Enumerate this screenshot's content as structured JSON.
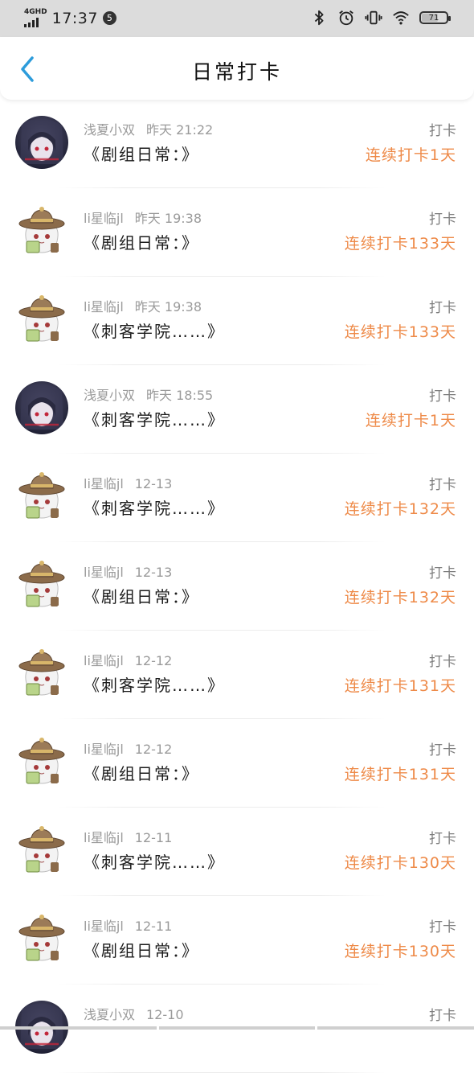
{
  "status_bar": {
    "network": "4GHD",
    "time": "17:37",
    "notification_count": "5",
    "battery": "71",
    "battery_level": 0.71,
    "icons": [
      "bluetooth-icon",
      "alarm-icon",
      "vibrate-icon",
      "wifi-icon",
      "battery-icon"
    ]
  },
  "header": {
    "title": "日常打卡",
    "back_icon": "chevron-left-icon"
  },
  "colors": {
    "accent": "#2d9cdb",
    "streak": "#ee8a48",
    "status_bar_bg": "#dcdcdc"
  },
  "entries": [
    {
      "user": "浅夏小双",
      "time": "昨天 21:22",
      "title": "《剧组日常：》",
      "action": "打卡",
      "streak": "连续打卡1天",
      "avatar": "dark-hair-girl"
    },
    {
      "user": "li星临jl",
      "time": "昨天 19:38",
      "title": "《剧组日常：》",
      "action": "打卡",
      "streak": "连续打卡133天",
      "avatar": "hat-chibi"
    },
    {
      "user": "li星临jl",
      "time": "昨天 19:38",
      "title": "《刺客学院……》",
      "action": "打卡",
      "streak": "连续打卡133天",
      "avatar": "hat-chibi"
    },
    {
      "user": "浅夏小双",
      "time": "昨天 18:55",
      "title": "《刺客学院……》",
      "action": "打卡",
      "streak": "连续打卡1天",
      "avatar": "dark-hair-girl"
    },
    {
      "user": "li星临jl",
      "time": "12-13",
      "title": "《刺客学院……》",
      "action": "打卡",
      "streak": "连续打卡132天",
      "avatar": "hat-chibi"
    },
    {
      "user": "li星临jl",
      "time": "12-13",
      "title": "《剧组日常：》",
      "action": "打卡",
      "streak": "连续打卡132天",
      "avatar": "hat-chibi"
    },
    {
      "user": "li星临jl",
      "time": "12-12",
      "title": "《刺客学院……》",
      "action": "打卡",
      "streak": "连续打卡131天",
      "avatar": "hat-chibi"
    },
    {
      "user": "li星临jl",
      "time": "12-12",
      "title": "《剧组日常：》",
      "action": "打卡",
      "streak": "连续打卡131天",
      "avatar": "hat-chibi"
    },
    {
      "user": "li星临jl",
      "time": "12-11",
      "title": "《刺客学院……》",
      "action": "打卡",
      "streak": "连续打卡130天",
      "avatar": "hat-chibi"
    },
    {
      "user": "li星临jl",
      "time": "12-11",
      "title": "《剧组日常：》",
      "action": "打卡",
      "streak": "连续打卡130天",
      "avatar": "hat-chibi"
    },
    {
      "user": "浅夏小双",
      "time": "12-10",
      "title": "",
      "action": "打卡",
      "streak": "",
      "avatar": "dark-hair-girl"
    }
  ]
}
